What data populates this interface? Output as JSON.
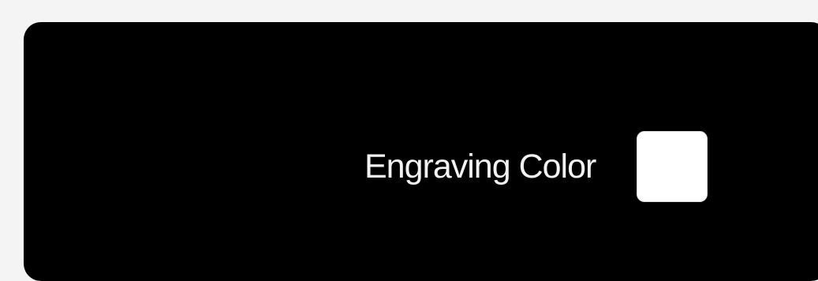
{
  "engraving": {
    "label": "Engraving Color",
    "swatch_color": "#ffffff"
  },
  "colors": {
    "panel_background": "#000000",
    "page_background": "#f4f4f4",
    "label_text": "#f2f2f2"
  }
}
